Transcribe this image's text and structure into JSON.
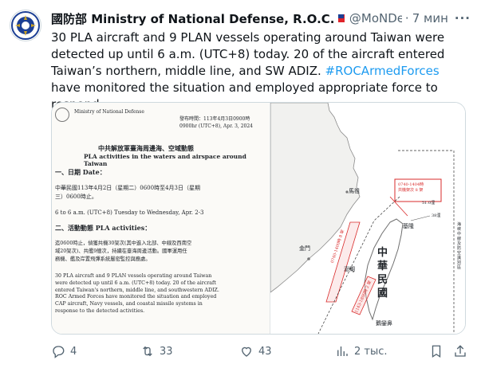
{
  "author": {
    "name": "國防部 Ministry of National Defense, R.O.C.",
    "handle": "@MoNDefense",
    "time": "7 мин",
    "more_label": "···"
  },
  "tweet": {
    "text_part1": "30 PLA aircraft and 9 PLAN vessels operating around Taiwan were detected up until 6 a.m. (UTC+8) today. 20 of the aircraft entered Taiwan’s northern, middle line, and SW ADIZ. ",
    "hashtag": "#ROCArmedForces",
    "text_part2": " have monitored the situation and employed appropriate force to respond."
  },
  "document": {
    "ministry": "Ministry of National Defense",
    "release_time": "發布時間：113年4月3日0900時\n0900hr (UTC+8), Apr. 3, 2024",
    "title_zh": "中共解放軍臺海周邊海、空域動態",
    "title_en": "PLA activities in the waters and airspace around Taiwan",
    "sec1_heading": "一、日期 Date：",
    "sec1_zh": "中華民國113年4月2日（星期二）0600時至4月3日（星期\n三）0600時止。",
    "sec1_en": "6 to 6 a.m. (UTC+8) Tuesday to Wednesday, Apr. 2-3",
    "sec2_heading": "二、活動動態 PLA activities：",
    "sec2_zh": "迄0600時止，偵獲共機30架次(其中進入北部、中線及西南空\n域20架次)、共艦9艘次，持續在臺海周邊活動。國軍運用任\n務機、艦及岸置飛彈系統嚴密監控與應處。",
    "sec2_en": "30 PLA aircraft and 9 PLAN vessels operating around Taiwan\nwere detected up until 6 a.m. (UTC+8) today. 20 of the aircraft\nentered Taiwan's northern, middle line, and southwestern ADIZ.\nROC Armed Forces have monitored the situation and employed\nCAP aircraft, Navy vessels, and coastal missile systems in\nresponse to the detected activities."
  },
  "map": {
    "label_matsu": "馬祖",
    "label_kinmen": "金門",
    "label_penghu": "澎湖",
    "label_keelung": "基隆",
    "label_taiwan": "中華民國",
    "label_eluanbi": "鵝鑾鼻",
    "box1_text": "0740-1404時\n共機架次 8 架",
    "box2_text": "0740-1400時 8 架",
    "box3_text": "1143-1800時 2 架",
    "nm_label1": "51.0浬",
    "nm_label2": "38浬",
    "side_text": "海峽中線及防空識別區",
    "accent_red": "#d92b2b"
  },
  "actions": {
    "replies": "4",
    "retweets": "33",
    "likes": "43",
    "views": "2 тыс."
  },
  "colors": {
    "text": "#0f1419",
    "secondary": "#536471",
    "link": "#1d9bf0",
    "border": "#cfd9de"
  }
}
